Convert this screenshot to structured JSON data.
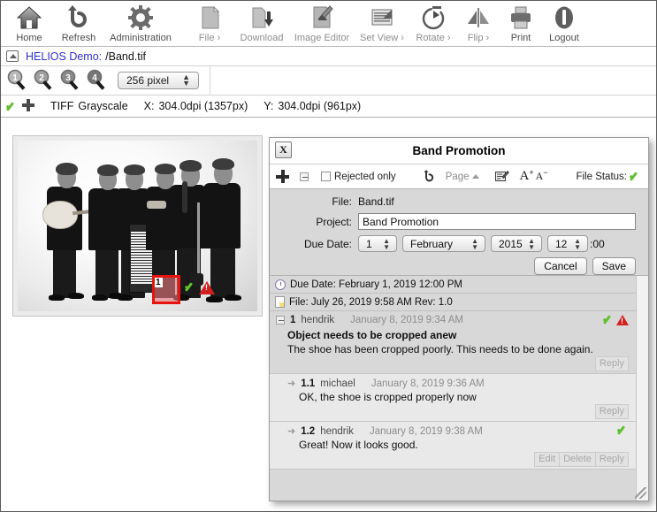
{
  "toolbar": {
    "items": [
      {
        "label": "Home",
        "icon": "home-icon",
        "dim": false
      },
      {
        "label": "Refresh",
        "icon": "refresh-icon",
        "dim": false
      },
      {
        "label": "Administration",
        "icon": "gear-icon",
        "dim": false
      },
      {
        "label": "File ›",
        "icon": "file-icon",
        "dim": true
      },
      {
        "label": "Download",
        "icon": "download-icon",
        "dim": true
      },
      {
        "label": "Image Editor",
        "icon": "image-editor-icon",
        "dim": true
      },
      {
        "label": "Set View ›",
        "icon": "set-view-icon",
        "dim": true
      },
      {
        "label": "Rotate ›",
        "icon": "rotate-icon",
        "dim": true
      },
      {
        "label": "Flip ›",
        "icon": "flip-icon",
        "dim": true
      },
      {
        "label": "Print",
        "icon": "print-icon",
        "dim": false
      },
      {
        "label": "Logout",
        "icon": "logout-icon",
        "dim": false
      }
    ]
  },
  "pathbar": {
    "up_icon": "up-directory-icon",
    "volume": "HELIOS Demo:",
    "path": "/Band.tif"
  },
  "zoombar": {
    "magnifiers": [
      "1",
      "2",
      "3",
      "4"
    ],
    "pixel_size": "256 pixel"
  },
  "infobar": {
    "status_icon": "green-check-icon",
    "move_icon": "move-cross-icon",
    "format": "TIFF",
    "colorspace": "Grayscale",
    "x_label": "X:",
    "x_value": "304.0dpi (1357px)",
    "y_label": "Y:",
    "y_value": "304.0dpi (961px)"
  },
  "preview": {
    "annotation_number": "1",
    "annotation_border_color": "#e8140f",
    "annotation_fill_color": "rgba(229,120,122,0.62)"
  },
  "panel": {
    "close_label": "X",
    "title": "Band Promotion",
    "toolbar": {
      "add_icon": "plus-icon",
      "collapse_icon": "collapse-icon",
      "rejected_only_label": "Rejected only",
      "refresh_icon": "refresh-icon",
      "page_label": "Page",
      "page_caret": "caret-up-icon",
      "edit_icon": "edit-note-icon",
      "font_bigger": "A",
      "font_bigger_sign": "+",
      "font_smaller": "A",
      "font_smaller_sign": "−",
      "file_status_label": "File Status:",
      "file_status_icon": "green-check-icon"
    },
    "form": {
      "file_label": "File:",
      "file_value": "Band.tif",
      "project_label": "Project:",
      "project_value": "Band Promotion",
      "due_date_label": "Due Date:",
      "day": "1",
      "month": "February",
      "year": "2015",
      "hour": "12",
      "minutes_suffix": ":00",
      "cancel_label": "Cancel",
      "save_label": "Save"
    },
    "meta": [
      {
        "icon": "clock-icon",
        "text": "Due Date: February 1, 2019 12:00 PM"
      },
      {
        "icon": "file-icon",
        "text": "File: July 26, 2019 9:58 AM  Rev: 1.0"
      }
    ],
    "comments": [
      {
        "level": 0,
        "id": "1",
        "user": "hendrik",
        "date": "January 8, 2019 9:34 AM",
        "subject": "Object needs to be cropped anew",
        "body": "The shoe has been cropped poorly. This needs to be done again.",
        "icons": [
          "green-check-icon",
          "red-warning-icon"
        ],
        "actions": [
          "Reply"
        ]
      },
      {
        "level": 1,
        "id": "1.1",
        "user": "michael",
        "date": "January 8, 2019 9:36 AM",
        "subject": "",
        "body": "OK, the shoe is cropped properly now",
        "icons": [],
        "actions": [
          "Reply"
        ]
      },
      {
        "level": 1,
        "id": "1.2",
        "user": "hendrik",
        "date": "January 8, 2019 9:38 AM",
        "subject": "",
        "body": "Great! Now it looks good.",
        "icons": [
          "green-check-icon"
        ],
        "actions": [
          "Edit",
          "Delete",
          "Reply"
        ]
      }
    ]
  },
  "colors": {
    "link": "#2f2fd0",
    "accent_green": "#62c22f",
    "accent_red": "#d31f1f",
    "annotation_red": "#e8140f"
  }
}
